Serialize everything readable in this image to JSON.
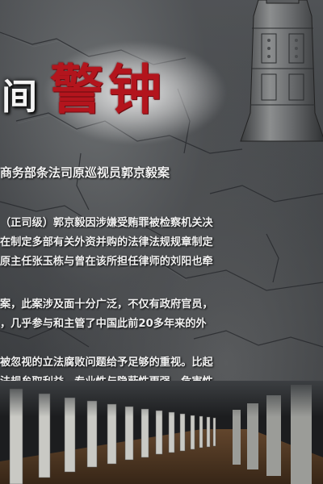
{
  "title": {
    "fragment": "间",
    "main": "警钟"
  },
  "subtitle": "商务部条法司原巡视员郭京毅案",
  "paragraphs": [
    {
      "lines": [
        "（正司级）郭京毅因涉嫌受贿罪被检察机关决",
        "在制定多部有关外资并购的法律法规规章制定",
        "原主任张玉栋与曾在该所担任律师的刘阳也牵"
      ]
    },
    {
      "lines": [
        "案，此案涉及面十分广泛，不仅有政府官员，",
        "，几乎参与和主管了中国此前20多年来的外"
      ]
    },
    {
      "lines": [
        "被忽视的立法腐败问题给予足够的重视。比起",
        "法规牟取利益，专业性与隐蔽性更强，危害性"
      ]
    }
  ],
  "decor": {
    "bell-icon": "bronze-bell",
    "stone-texture": "cracked-stone",
    "colonnade-image": "corridor-columns",
    "colors": {
      "title_red": "#b3151d",
      "text": "#f0f0f0",
      "stone_dark": "#2f3134",
      "stone_light": "#6b6e70"
    }
  }
}
